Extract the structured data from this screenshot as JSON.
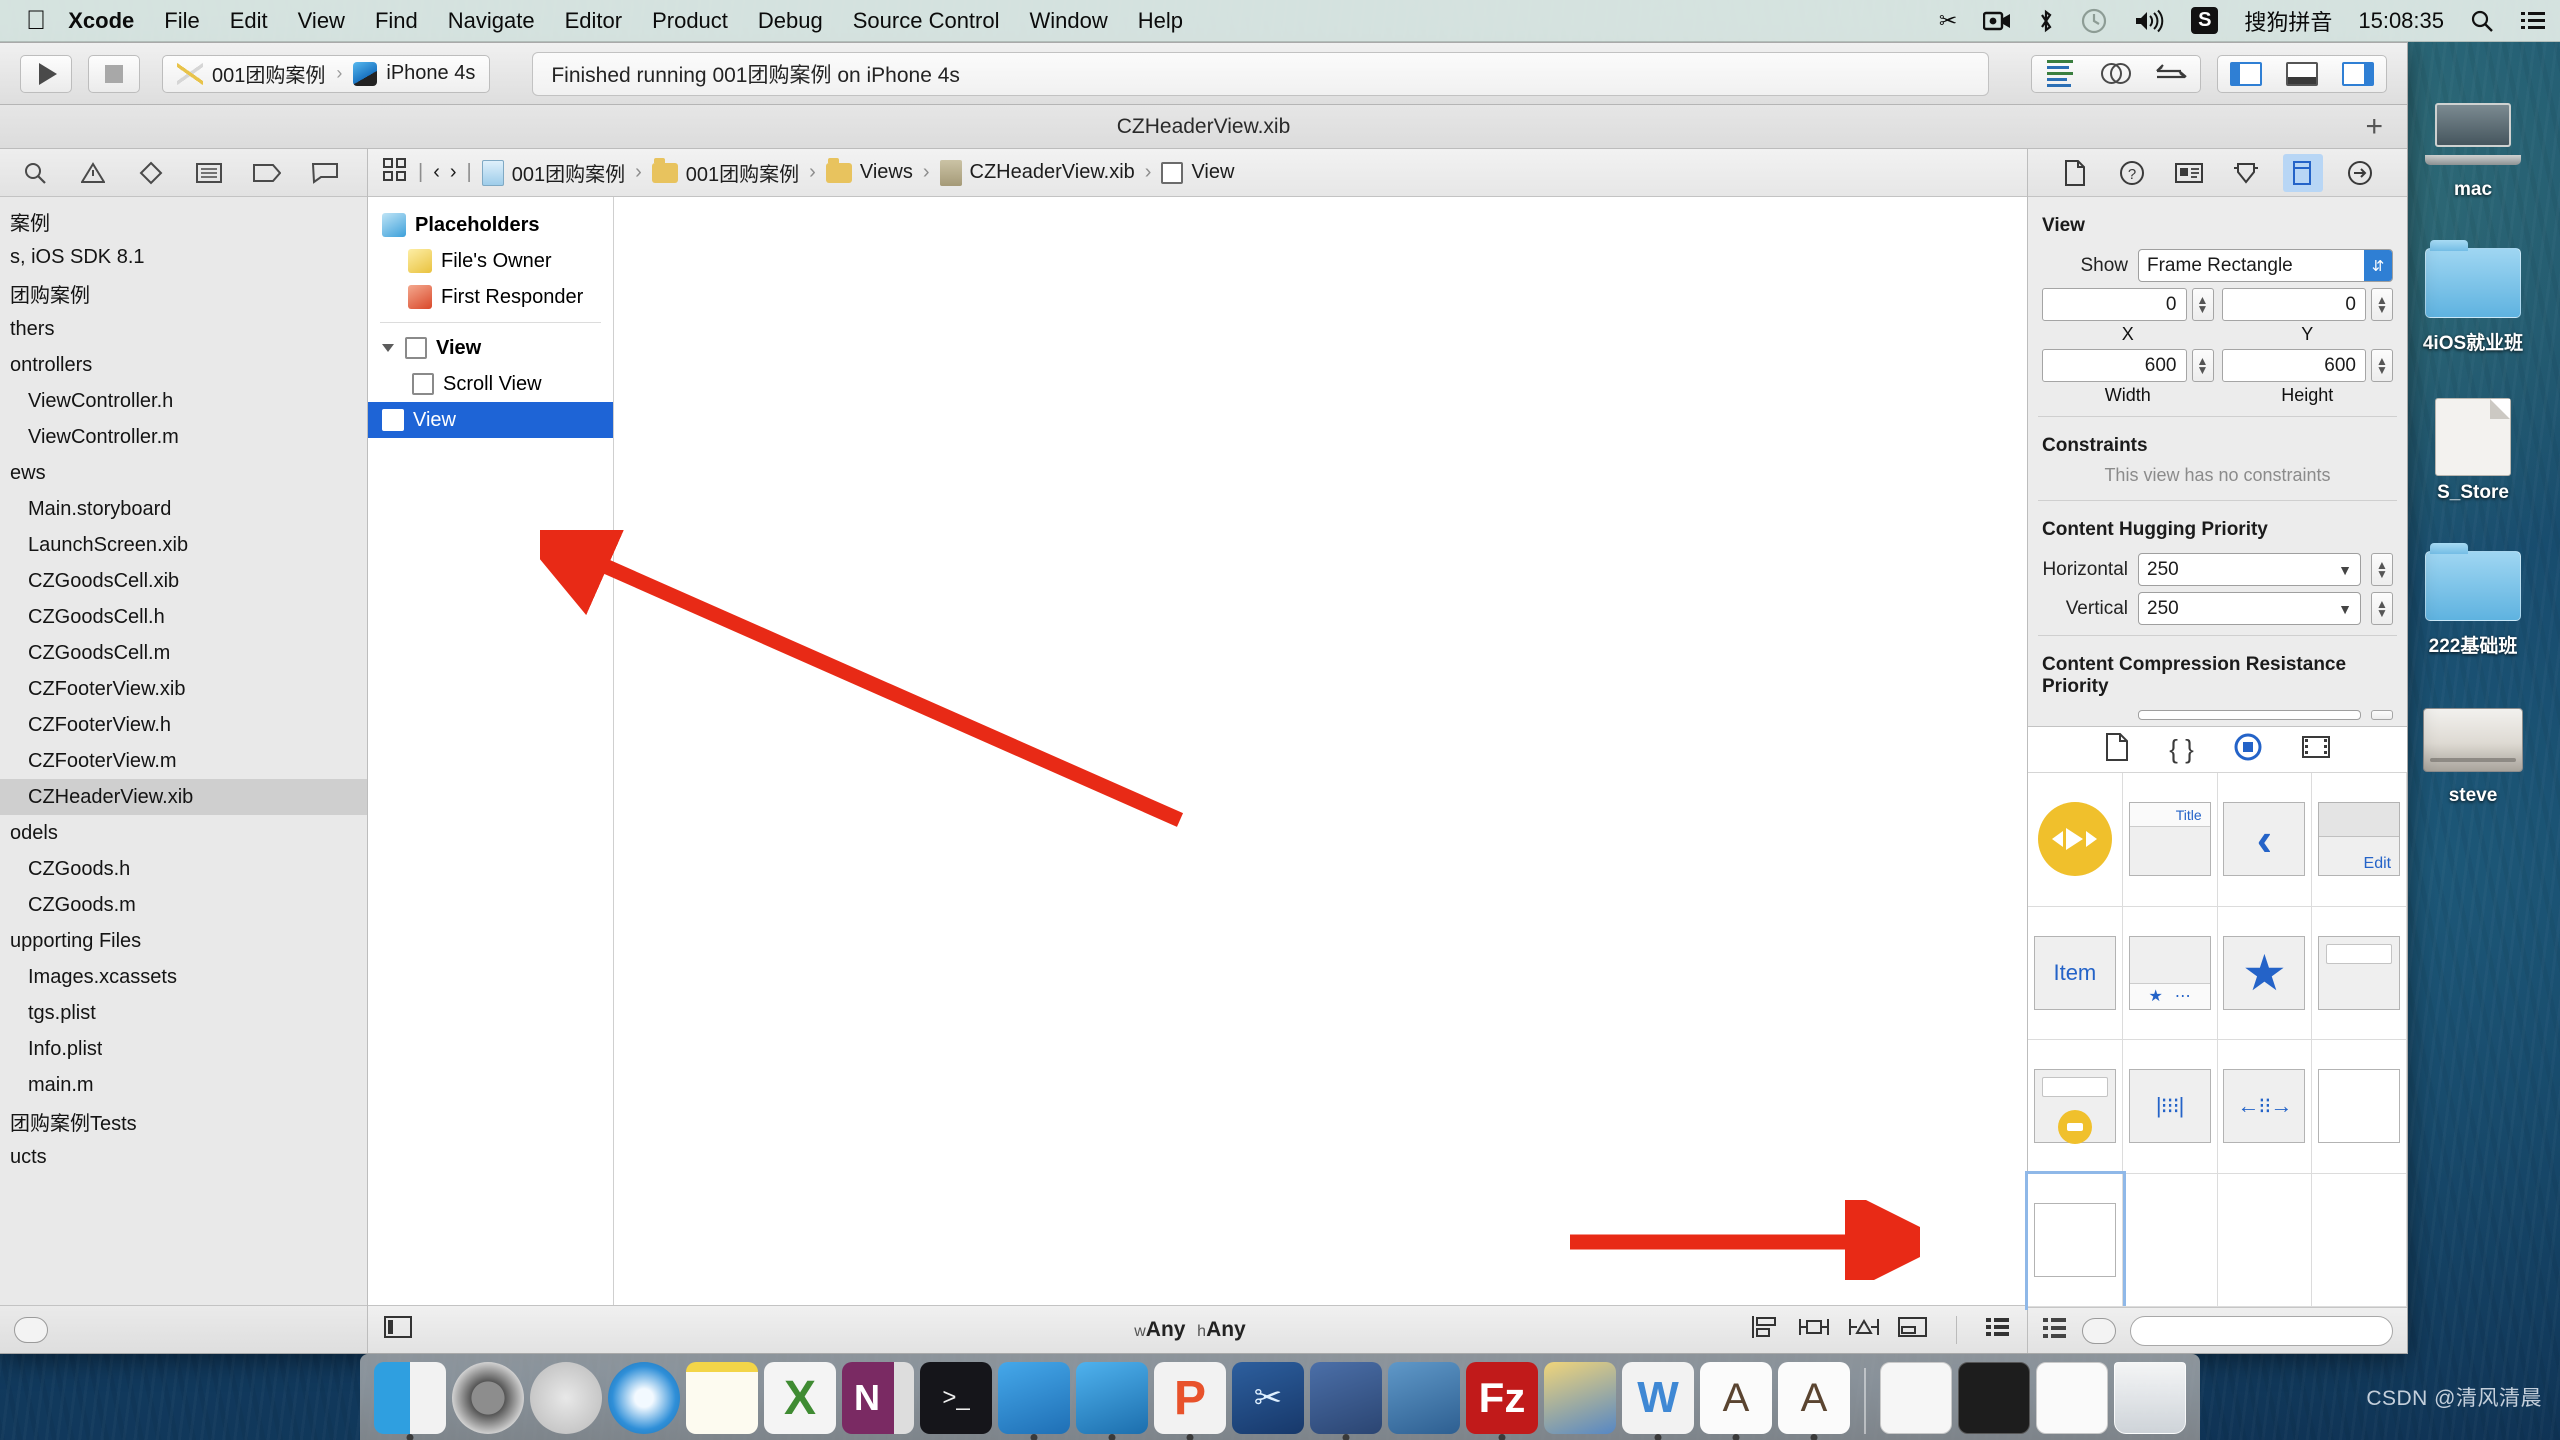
{
  "menubar": {
    "apple_icon": "apple-logo-icon",
    "items": [
      {
        "label": "Xcode",
        "bold": true
      },
      {
        "label": "File",
        "bold": false
      },
      {
        "label": "Edit",
        "bold": false
      },
      {
        "label": "View",
        "bold": false
      },
      {
        "label": "Find",
        "bold": false
      },
      {
        "label": "Navigate",
        "bold": false
      },
      {
        "label": "Editor",
        "bold": false
      },
      {
        "label": "Product",
        "bold": false
      },
      {
        "label": "Debug",
        "bold": false
      },
      {
        "label": "Source Control",
        "bold": false
      },
      {
        "label": "Window",
        "bold": false
      },
      {
        "label": "Help",
        "bold": false
      }
    ],
    "status_icons": [
      "scissors-icon",
      "video-camera-icon",
      "bluetooth-icon",
      "time-machine-icon",
      "volume-icon"
    ],
    "input_method_badge": "S",
    "input_method_label": "搜狗拼音",
    "clock": "15:08:35",
    "search_icon": "search-icon",
    "notification_icon": "notification-center-icon"
  },
  "toolbar": {
    "run_icon": "play-icon",
    "stop_icon": "stop-icon",
    "scheme_name": "001团购案例",
    "scheme_separator": "›",
    "destination": "iPhone 4s",
    "status_text": "Finished running 001团购案例 on iPhone 4s",
    "editor_modes": [
      "standard-editor-icon",
      "assistant-editor-icon",
      "version-editor-icon"
    ],
    "view_toggles": [
      "navigator-toggle-icon",
      "debug-area-toggle-icon",
      "utilities-toggle-icon"
    ]
  },
  "titlebar": {
    "document_title": "CZHeaderView.xib",
    "add_tab_label": "+"
  },
  "navigator": {
    "tabs": [
      "project-navigator-icon",
      "issue-navigator-icon",
      "test-navigator-icon",
      "debug-navigator-icon",
      "breakpoint-navigator-icon",
      "report-navigator-icon"
    ],
    "items": [
      {
        "label": "案例",
        "indent": 0,
        "selected": false
      },
      {
        "label": "s, iOS SDK 8.1",
        "indent": 0,
        "selected": false
      },
      {
        "label": "团购案例",
        "indent": 0,
        "selected": false
      },
      {
        "label": "thers",
        "indent": 0,
        "selected": false
      },
      {
        "label": "ontrollers",
        "indent": 0,
        "selected": false
      },
      {
        "label": "ViewController.h",
        "indent": 1,
        "selected": false
      },
      {
        "label": "ViewController.m",
        "indent": 1,
        "selected": false
      },
      {
        "label": "ews",
        "indent": 0,
        "selected": false
      },
      {
        "label": "Main.storyboard",
        "indent": 1,
        "selected": false
      },
      {
        "label": "LaunchScreen.xib",
        "indent": 1,
        "selected": false
      },
      {
        "label": "CZGoodsCell.xib",
        "indent": 1,
        "selected": false
      },
      {
        "label": "CZGoodsCell.h",
        "indent": 1,
        "selected": false
      },
      {
        "label": "CZGoodsCell.m",
        "indent": 1,
        "selected": false
      },
      {
        "label": "CZFooterView.xib",
        "indent": 1,
        "selected": false
      },
      {
        "label": "CZFooterView.h",
        "indent": 1,
        "selected": false
      },
      {
        "label": "CZFooterView.m",
        "indent": 1,
        "selected": false
      },
      {
        "label": "CZHeaderView.xib",
        "indent": 1,
        "selected": true
      },
      {
        "label": "odels",
        "indent": 0,
        "selected": false
      },
      {
        "label": "CZGoods.h",
        "indent": 1,
        "selected": false
      },
      {
        "label": "CZGoods.m",
        "indent": 1,
        "selected": false
      },
      {
        "label": "upporting Files",
        "indent": 0,
        "selected": false
      },
      {
        "label": "Images.xcassets",
        "indent": 1,
        "selected": false
      },
      {
        "label": "tgs.plist",
        "indent": 1,
        "selected": false
      },
      {
        "label": "Info.plist",
        "indent": 1,
        "selected": false
      },
      {
        "label": "main.m",
        "indent": 1,
        "selected": false
      },
      {
        "label": "团购案例Tests",
        "indent": 0,
        "selected": false
      },
      {
        "label": "ucts",
        "indent": 0,
        "selected": false
      }
    ],
    "filter_icon": "filter-icon"
  },
  "breadcrumb": {
    "grid_icon": "related-items-icon",
    "back_icon": "back-chevron-icon",
    "forward_icon": "forward-chevron-icon",
    "items": [
      {
        "label": "001团购案例",
        "icon": "project-icon"
      },
      {
        "label": "001团购案例",
        "icon": "folder-icon"
      },
      {
        "label": "Views",
        "icon": "folder-icon"
      },
      {
        "label": "CZHeaderView.xib",
        "icon": "xib-icon"
      },
      {
        "label": "View",
        "icon": "view-icon"
      }
    ],
    "separator": "›"
  },
  "outline": {
    "rows": [
      {
        "label": "Placeholders",
        "icon": "placeholder-cube-icon",
        "indent": 0,
        "bold": true,
        "selected": false
      },
      {
        "label": "File's Owner",
        "icon": "files-owner-cube-icon",
        "indent": 1,
        "bold": false,
        "selected": false
      },
      {
        "label": "First Responder",
        "icon": "first-responder-cube-icon",
        "indent": 1,
        "bold": false,
        "selected": false
      },
      {
        "label": "View",
        "icon": "view-square-icon",
        "indent": 0,
        "bold": true,
        "selected": false,
        "disclosure": true
      },
      {
        "label": "Scroll View",
        "icon": "scroll-view-icon",
        "indent": 1,
        "bold": false,
        "selected": false
      },
      {
        "label": "View",
        "icon": "view-square-icon",
        "indent": 0,
        "bold": false,
        "selected": true
      }
    ]
  },
  "editor_footer": {
    "left_icon": "outline-toggle-icon",
    "size_class_w": "w",
    "size_class_w_val": "Any",
    "size_class_h": "h",
    "size_class_h_val": "Any",
    "align_icons": [
      "align-icon",
      "pin-icon",
      "resolve-issues-icon",
      "resizing-behavior-icon"
    ],
    "list_icon": "list-view-icon",
    "zoom_icon": "zoom-icon"
  },
  "inspector": {
    "tabs": [
      "file-inspector-icon",
      "quick-help-icon",
      "identity-inspector-icon",
      "attributes-inspector-icon",
      "size-inspector-icon",
      "connections-inspector-icon"
    ],
    "active_tab_index": 4,
    "section_title": "View",
    "show_label": "Show",
    "show_value": "Frame Rectangle",
    "x_value": "0",
    "x_label": "X",
    "y_value": "0",
    "y_label": "Y",
    "width_value": "600",
    "width_label": "Width",
    "height_value": "600",
    "height_label": "Height",
    "constraints_title": "Constraints",
    "constraints_note": "This view has no constraints",
    "hugging_title": "Content Hugging Priority",
    "hugging_horizontal_label": "Horizontal",
    "hugging_horizontal_value": "250",
    "hugging_vertical_label": "Vertical",
    "hugging_vertical_value": "250",
    "compression_title": "Content Compression Resistance Priority"
  },
  "library": {
    "tabs": [
      "file-template-library-icon",
      "code-snippet-library-icon",
      "object-library-icon",
      "media-library-icon"
    ],
    "active_tab_index": 2,
    "items": [
      {
        "name": "media-controls-icon",
        "label": ""
      },
      {
        "name": "navigation-bar-icon",
        "label": "Title"
      },
      {
        "name": "navigation-item-icon",
        "label": ""
      },
      {
        "name": "toolbar-icon",
        "label": "Edit"
      },
      {
        "name": "bar-button-item-icon",
        "label": "Item"
      },
      {
        "name": "tab-bar-icon",
        "label": ""
      },
      {
        "name": "tab-bar-item-icon",
        "label": ""
      },
      {
        "name": "search-bar-icon",
        "label": ""
      },
      {
        "name": "search-bar-with-scope-icon",
        "label": ""
      },
      {
        "name": "vertical-spacer-icon",
        "label": ""
      },
      {
        "name": "horizontal-spacer-icon",
        "label": ""
      },
      {
        "name": "view-object-icon",
        "label": ""
      },
      {
        "name": "container-view-icon",
        "label": ""
      }
    ],
    "selected_index": 12
  },
  "desktop": {
    "icons": [
      {
        "label": "mac",
        "type": "laptop"
      },
      {
        "label": "4iOS就业班",
        "type": "folder"
      },
      {
        "label": "S_Store",
        "type": "document"
      },
      {
        "label": "222基础班",
        "type": "folder"
      },
      {
        "label": "steve",
        "type": "harddisk"
      }
    ],
    "watermark": "CSDN @清风清晨"
  },
  "dock": {
    "items": [
      {
        "name": "finder-icon",
        "running": true
      },
      {
        "name": "system-preferences-icon",
        "running": false
      },
      {
        "name": "launchpad-icon",
        "running": false
      },
      {
        "name": "safari-icon",
        "running": false
      },
      {
        "name": "notes-icon",
        "running": false
      },
      {
        "name": "excel-icon",
        "running": false
      },
      {
        "name": "onenote-icon",
        "running": false
      },
      {
        "name": "terminal-icon",
        "running": false
      },
      {
        "name": "xcode-icon",
        "running": true
      },
      {
        "name": "ios-simulator-icon",
        "running": true
      },
      {
        "name": "php-storm-icon",
        "running": true
      },
      {
        "name": "snipaste-icon",
        "running": false
      },
      {
        "name": "quicktime-icon",
        "running": true
      },
      {
        "name": "filezilla-icon",
        "running": false
      },
      {
        "name": "paintbrush-icon",
        "running": true
      },
      {
        "name": "word-icon",
        "running": false
      },
      {
        "name": "sketchbook-icon",
        "running": true
      },
      {
        "name": "sketchbook2-icon",
        "running": true
      }
    ],
    "recent": [
      {
        "name": "recent-doc-icon"
      },
      {
        "name": "recent-display-icon"
      },
      {
        "name": "recent-window-icon"
      }
    ],
    "trash": {
      "name": "trash-icon"
    }
  }
}
